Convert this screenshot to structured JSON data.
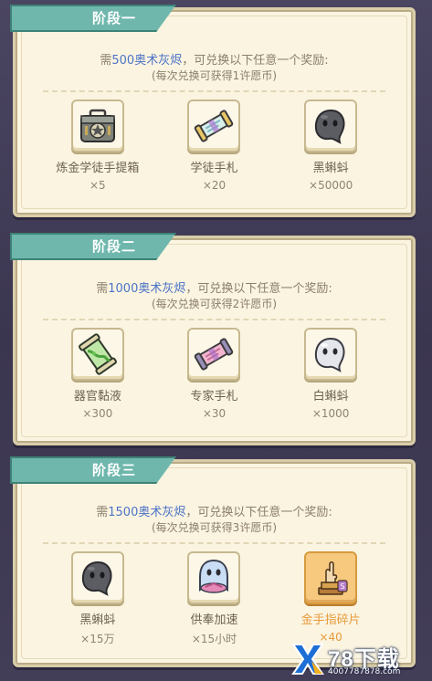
{
  "stages": [
    {
      "title": "阶段一",
      "req_prefix": "需",
      "req_amount": "500奥术灰烬",
      "req_suffix": "，可兑换以下任意一个奖励:",
      "note": "(每次兑换可获得1许愿币)",
      "rewards": [
        {
          "name": "炼金学徒手提箱",
          "qty": "×5",
          "icon": "toolbox-icon"
        },
        {
          "name": "学徒手札",
          "qty": "×20",
          "icon": "scroll-icon"
        },
        {
          "name": "黑蝌蚪",
          "qty": "×50000",
          "icon": "black-tadpole-icon"
        }
      ]
    },
    {
      "title": "阶段二",
      "req_prefix": "需",
      "req_amount": "1000奥术灰烬",
      "req_suffix": "，可兑换以下任意一个奖励:",
      "note": "(每次兑换可获得2许愿币)",
      "rewards": [
        {
          "name": "器官黏液",
          "qty": "×300",
          "icon": "organ-slime-vial-icon"
        },
        {
          "name": "专家手札",
          "qty": "×30",
          "icon": "expert-scroll-icon"
        },
        {
          "name": "白蝌蚪",
          "qty": "×1000",
          "icon": "white-tadpole-icon"
        }
      ]
    },
    {
      "title": "阶段三",
      "req_prefix": "需",
      "req_amount": "1500奥术灰烬",
      "req_suffix": "，可兑换以下任意一个奖励:",
      "note": "(每次兑换可获得3许愿币)",
      "rewards": [
        {
          "name": "黑蝌蚪",
          "qty": "×15万",
          "icon": "black-tadpole-icon"
        },
        {
          "name": "供奉加速",
          "qty": "×15小时",
          "icon": "ghost-speedup-icon"
        },
        {
          "name": "金手指碎片",
          "qty": "×40",
          "icon": "golden-finger-fragment-icon",
          "highlight": true
        }
      ]
    }
  ],
  "watermark": {
    "brand": "78下载",
    "url": "4007787878.com"
  },
  "colors": {
    "tab": "#6fb7ad",
    "highlight_text": "#4b73c6",
    "orange_text": "#e79a3a",
    "panel_bg": "#fbf4e1"
  }
}
